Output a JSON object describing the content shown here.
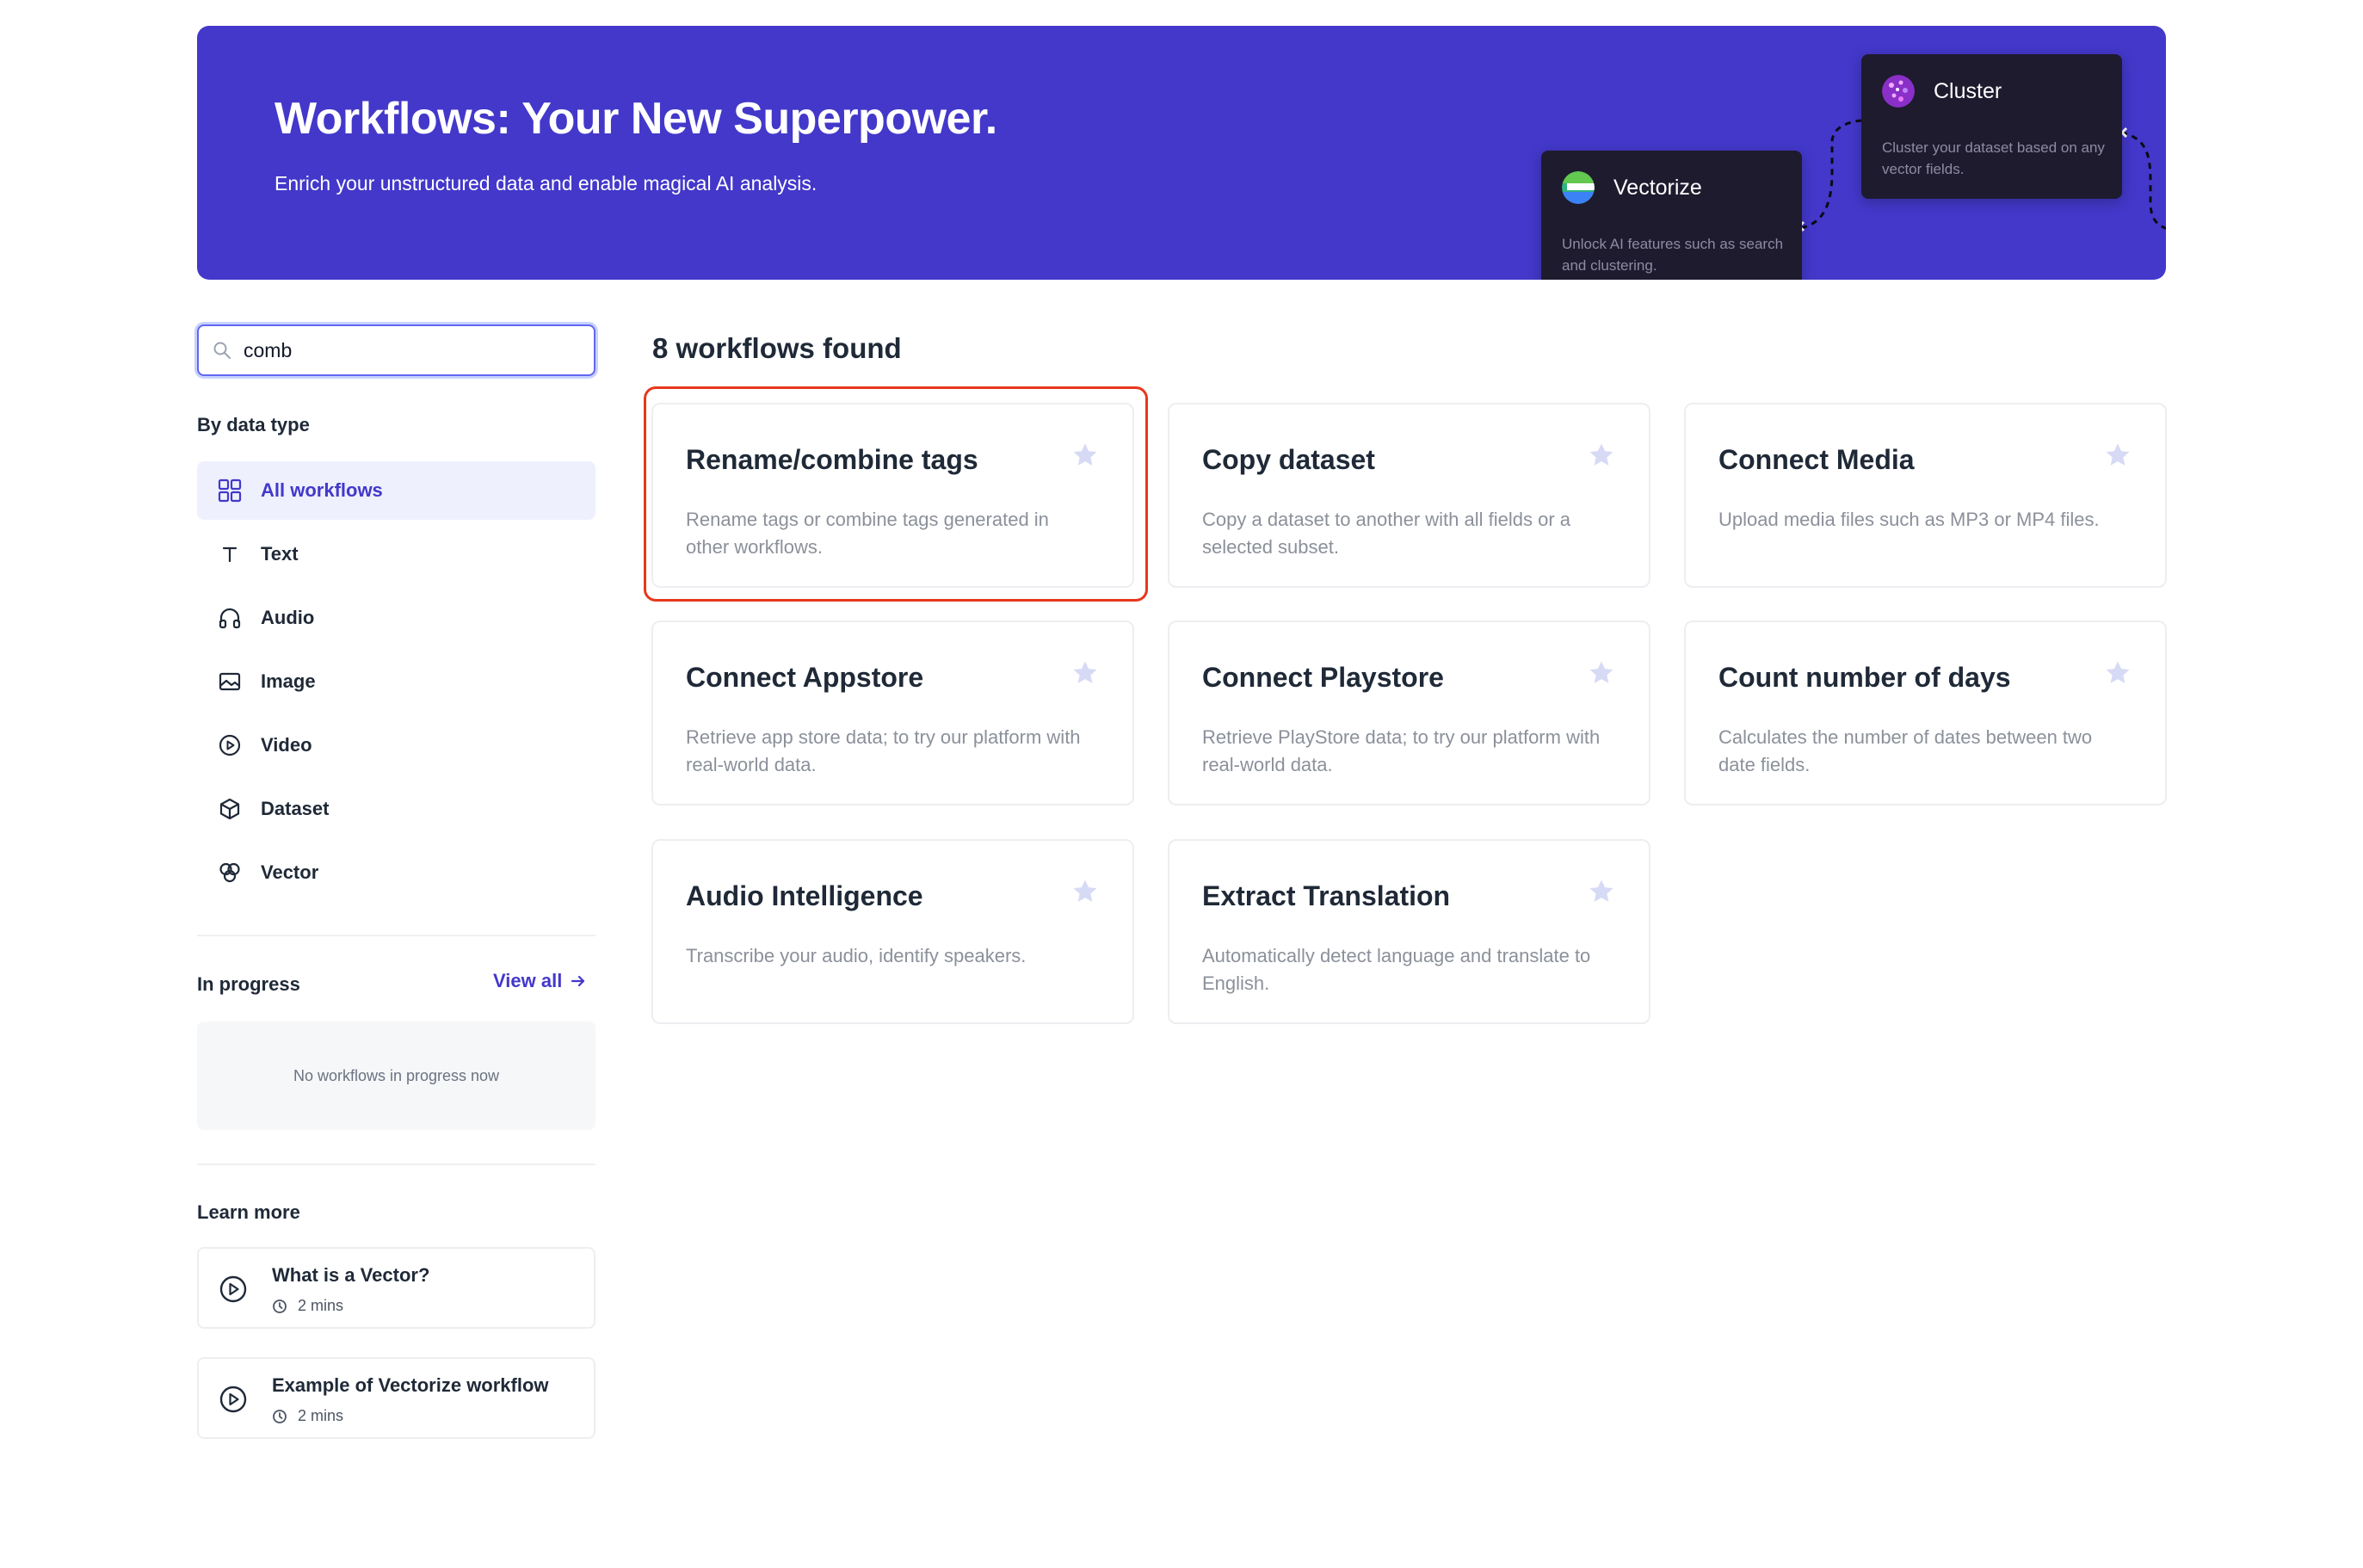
{
  "hero": {
    "title": "Workflows: Your New Superpower.",
    "subtitle": "Enrich your unstructured data and enable magical AI analysis.",
    "cards": [
      {
        "title": "Vectorize",
        "description": "Unlock AI features such as search and clustering.",
        "icon": "vectorize-icon"
      },
      {
        "title": "Cluster",
        "description": "Cluster your dataset based on any vector fields.",
        "icon": "cluster-icon"
      }
    ]
  },
  "search": {
    "value": "comb",
    "icon": "search-icon"
  },
  "sidebar": {
    "data_type_label": "By data type",
    "items": [
      {
        "label": "All workflows",
        "icon": "grid-icon",
        "active": true
      },
      {
        "label": "Text",
        "icon": "text-icon"
      },
      {
        "label": "Audio",
        "icon": "headphones-icon"
      },
      {
        "label": "Image",
        "icon": "image-icon"
      },
      {
        "label": "Video",
        "icon": "play-circle-icon"
      },
      {
        "label": "Dataset",
        "icon": "cube-icon"
      },
      {
        "label": "Vector",
        "icon": "vector-icon"
      }
    ],
    "in_progress": {
      "label": "In progress",
      "view_all": "View all",
      "empty": "No workflows in progress now"
    },
    "learn_more": {
      "label": "Learn more",
      "items": [
        {
          "title": "What is a Vector?",
          "duration": "2 mins"
        },
        {
          "title": "Example of Vectorize workflow",
          "duration": "2 mins"
        }
      ]
    }
  },
  "main": {
    "results_heading": "8 workflows found",
    "workflows": [
      {
        "title": "Rename/combine tags",
        "description": "Rename tags or combine tags generated in other workflows.",
        "highlighted": true
      },
      {
        "title": "Copy dataset",
        "description": "Copy a dataset to another with all fields or a selected subset."
      },
      {
        "title": "Connect Media",
        "description": "Upload media files such as MP3 or MP4 files."
      },
      {
        "title": "Connect Appstore",
        "description": "Retrieve app store data; to try our platform with real-world data."
      },
      {
        "title": "Connect Playstore",
        "description": "Retrieve PlayStore data; to try our platform with real-world data."
      },
      {
        "title": "Count number of days",
        "description": "Calculates the number of dates between two date fields."
      },
      {
        "title": "Audio Intelligence",
        "description": "Transcribe your audio, identify speakers."
      },
      {
        "title": "Extract Translation",
        "description": "Automatically detect language and translate to English."
      }
    ]
  },
  "colors": {
    "brand": "#4338ca",
    "hero_bg": "#4338ca",
    "promo_bg": "#1e1b2e",
    "highlight": "#e8371c",
    "star": "#d6daf5"
  }
}
